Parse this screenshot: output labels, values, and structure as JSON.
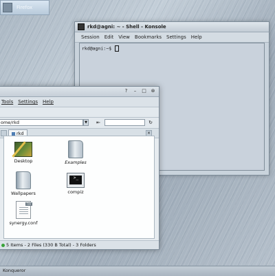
{
  "desktop": {
    "top_icon_label": "Firefox"
  },
  "konsole": {
    "title": "rkd@agni: ~ - Shell - Konsole",
    "menu": [
      "Session",
      "Edit",
      "View",
      "Bookmarks",
      "Settings",
      "Help"
    ],
    "prompt": "rkd@agni:~$"
  },
  "file_manager": {
    "menu": [
      "Tools",
      "Settings",
      "Help"
    ],
    "location": "ome/rkd",
    "tab_label": "rkd",
    "items": [
      {
        "label": "Desktop",
        "icon": "desktop-folder-icon"
      },
      {
        "label": "Examples",
        "icon": "folder-icon"
      },
      {
        "label": "Wallpapers",
        "icon": "folder-icon"
      },
      {
        "label": "compiz",
        "icon": "terminal-script-icon"
      },
      {
        "label": "synergy.conf",
        "icon": "text-file-icon"
      }
    ],
    "status": "5 Items - 2 Files (330 B Total) - 3 Folders"
  },
  "taskbar": {
    "label": "Konqueror"
  }
}
